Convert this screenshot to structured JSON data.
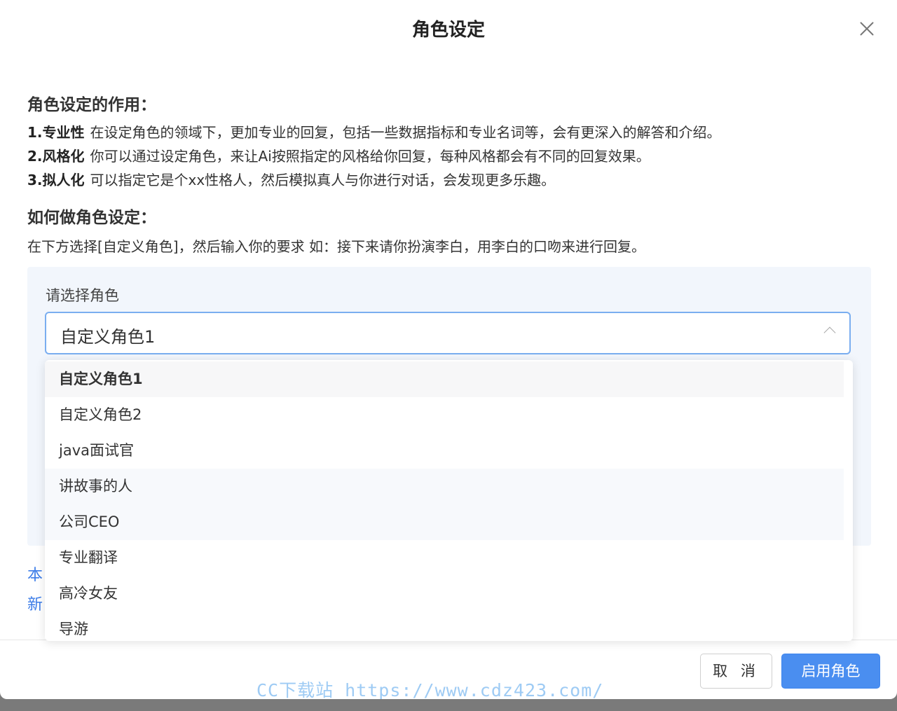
{
  "dialog": {
    "title": "角色设定",
    "close_icon": "close-icon"
  },
  "intro": {
    "heading": "角色设定的作用：",
    "items": [
      {
        "bold": "1.专业性",
        "text": "在设定角色的领域下，更加专业的回复，包括一些数据指标和专业名词等，会有更深入的解答和介绍。"
      },
      {
        "bold": "2.风格化",
        "text": "你可以通过设定角色，来让Ai按照指定的风格给你回复，每种风格都会有不同的回复效果。"
      },
      {
        "bold": "3.拟人化",
        "text": "可以指定它是个xx性格人，然后模拟真人与你进行对话，会发现更多乐趣。"
      }
    ]
  },
  "howto": {
    "heading": "如何做角色设定：",
    "text": "在下方选择[自定义角色]，然后输入你的要求 如：接下来请你扮演李白，用李白的口吻来进行回复。"
  },
  "select": {
    "label": "请选择角色",
    "value": "自定义角色1",
    "options": [
      "自定义角色1",
      "自定义角色2",
      "java面试官",
      "讲故事的人",
      "公司CEO",
      "专业翻译",
      "高冷女友",
      "导游"
    ]
  },
  "links": [
    "本",
    "新"
  ],
  "footer": {
    "cancel": "取 消",
    "confirm": "启用角色"
  },
  "watermark": "CC下载站 https://www.cdz423.com/",
  "colors": {
    "primary": "#4a8ef0",
    "link": "#3d7de8",
    "panel": "#f2f6fc"
  }
}
